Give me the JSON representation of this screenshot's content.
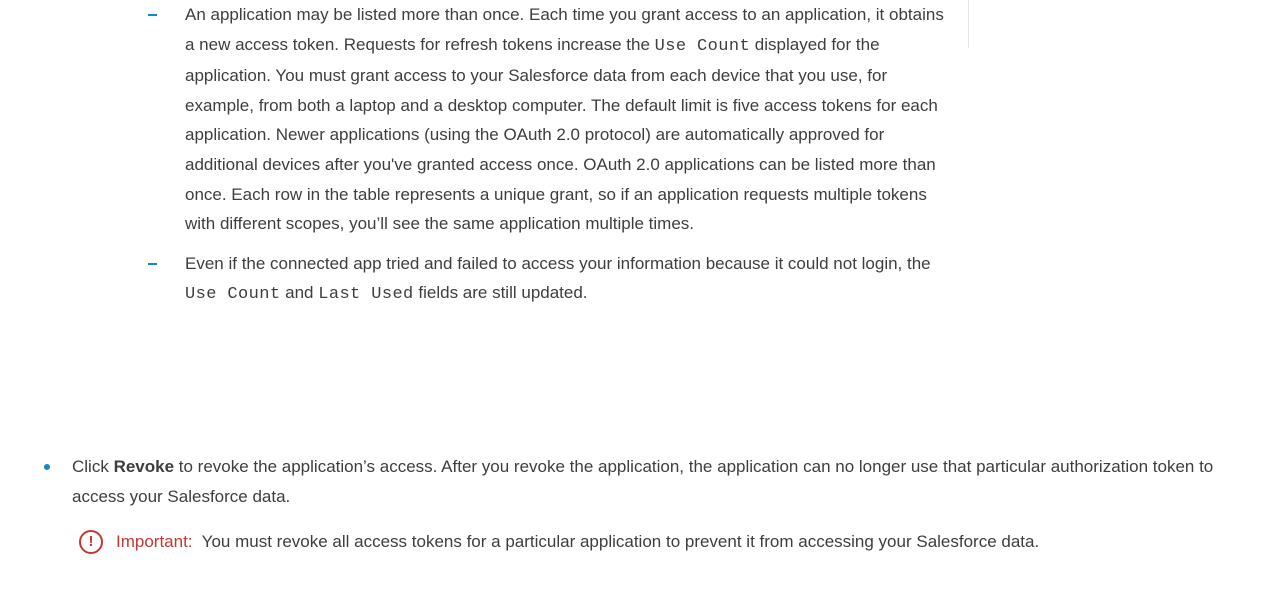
{
  "sub_items": [
    {
      "p1": "An application may be listed more than once. Each time you grant access to an application, it obtains a new access token. Requests for refresh tokens increase the ",
      "code1": "Use Count",
      "p2": " displayed for the application. You must grant access to your Salesforce data from each device that you use, for example, from both a laptop and a desktop computer. The default limit is five access tokens for each application. Newer applications (using the OAuth 2.0 protocol) are automatically approved for additional devices after you've granted access once. OAuth 2.0 applications can be listed more than once. Each row in the table represents a unique grant, so if an application requests multiple tokens with different scopes, you’ll see the same application multiple times."
    },
    {
      "p1": "Even if the connected app tried and failed to access your information because it could not login, the ",
      "code1": "Use Count",
      "p2": " and ",
      "code2": "Last Used",
      "p3": " fields are still updated."
    }
  ],
  "revoke_item": {
    "prefix": "Click ",
    "bold": "Revoke",
    "rest": " to revoke the application’s access. After you revoke the application, the application can no longer use that particular authorization token to access your Salesforce data."
  },
  "important_note": {
    "icon": "exclamation-circle-icon",
    "label": "Important:",
    "text": "  You must revoke all access tokens for a particular application to prevent it from accessing your Salesforce data."
  },
  "colors": {
    "accent": "#0f89c9",
    "important": "#c23934",
    "text": "#3e3e3c"
  }
}
